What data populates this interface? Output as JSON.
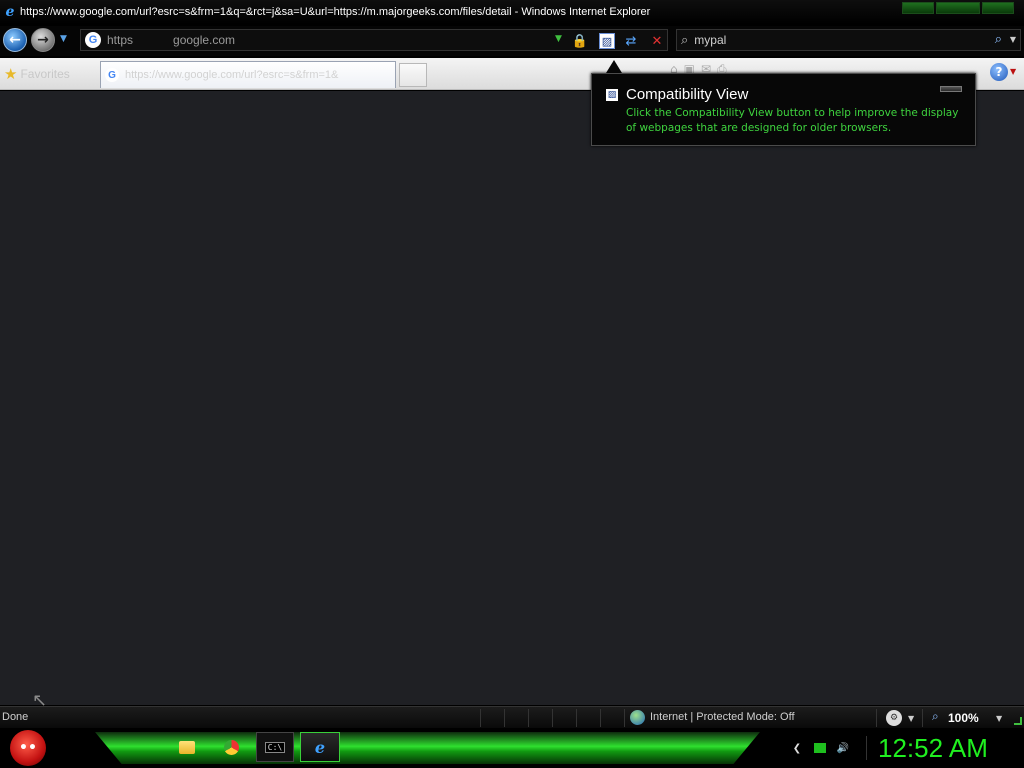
{
  "window": {
    "title": "https://www.google.com/url?esrc=s&frm=1&q=&rct=j&sa=U&url=https://m.majorgeeks.com/files/detail - Windows Internet Explorer"
  },
  "address_bar": {
    "scheme": "https",
    "domain": "google.com"
  },
  "search": {
    "value": "mypal"
  },
  "favorites": {
    "label": "Favorites"
  },
  "tab": {
    "title": "https://www.google.com/url?esrc=s&frm=1&"
  },
  "popup": {
    "title": "Compatibility View",
    "body": "Click the Compatibility View button to help improve the display of webpages that are designed for older browsers."
  },
  "statusbar": {
    "status": "Done",
    "zone": "Internet | Protected Mode: Off",
    "zoom": "100%"
  },
  "taskbar": {
    "clock": "12:52 AM"
  },
  "colors": {
    "accent_green": "#20f020",
    "popup_text_green": "#3fd43f",
    "content_bg": "#1f2024"
  }
}
